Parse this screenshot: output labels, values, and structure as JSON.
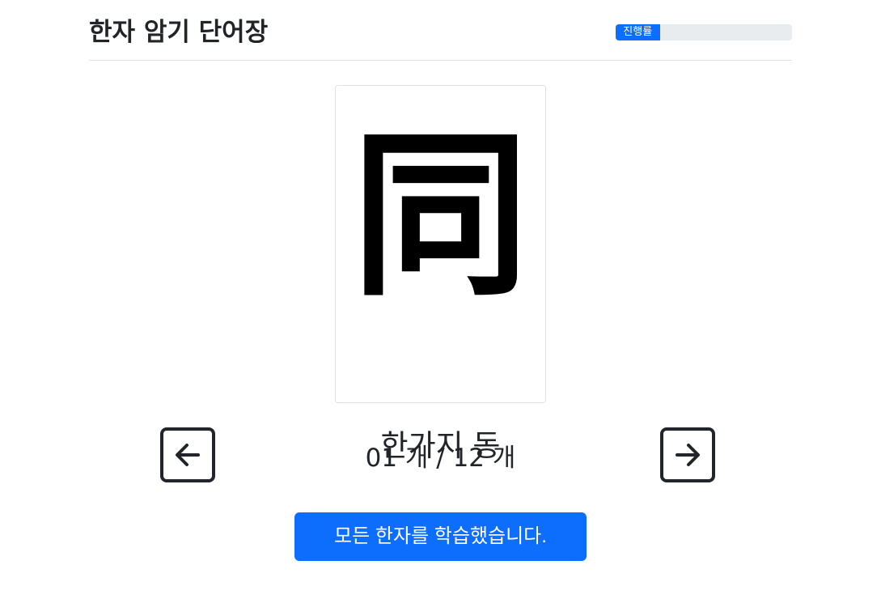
{
  "header": {
    "title": "한자 암기 단어장",
    "progress_label": "진행률",
    "progress_percent": 25
  },
  "card": {
    "hanja": "同",
    "meaning": "한가지 동"
  },
  "navigation": {
    "prev_icon": "arrow-left-icon",
    "next_icon": "arrow-right-icon",
    "counter": "01 개 / 12 개"
  },
  "actions": {
    "complete_label": "모든 한자를 학습했습니다."
  },
  "colors": {
    "accent": "#0d6efd",
    "text": "#212529"
  }
}
